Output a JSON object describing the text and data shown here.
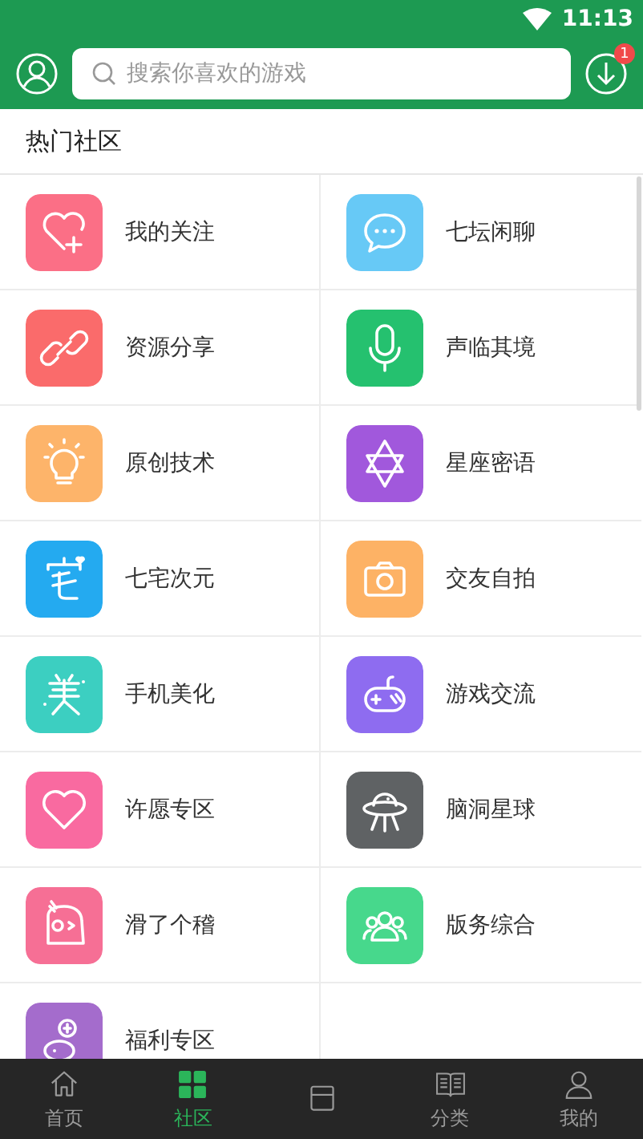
{
  "status_bar": {
    "time": "11:13"
  },
  "header": {
    "search": {
      "placeholder": "搜索你喜欢的游戏"
    },
    "download_badge": "1"
  },
  "section_title": "热门社区",
  "communities": [
    {
      "label": "我的关注",
      "color": "#fb6f86"
    },
    {
      "label": "七坛闲聊",
      "color": "#67c9f6"
    },
    {
      "label": "资源分享",
      "color": "#fa6b6b"
    },
    {
      "label": "声临其境",
      "color": "#25c16f"
    },
    {
      "label": "原创技术",
      "color": "#fdb46a"
    },
    {
      "label": "星座密语",
      "color": "#a158dc"
    },
    {
      "label": "七宅次元",
      "color": "#24aaf0"
    },
    {
      "label": "交友自拍",
      "color": "#fdb265"
    },
    {
      "label": "手机美化",
      "color": "#3ccfc1"
    },
    {
      "label": "游戏交流",
      "color": "#8e6cf0"
    },
    {
      "label": "许愿专区",
      "color": "#f96aa0"
    },
    {
      "label": "脑洞星球",
      "color": "#5f6264"
    },
    {
      "label": "滑了个稽",
      "color": "#f66f95"
    },
    {
      "label": "版务综合",
      "color": "#47d88c"
    },
    {
      "label": "福利专区",
      "color": "#a46ccc"
    }
  ],
  "tabs": [
    {
      "label": "首页",
      "selected": false
    },
    {
      "label": "社区",
      "selected": true
    },
    {
      "selected": false
    },
    {
      "label": "分类",
      "selected": false
    },
    {
      "label": "我的",
      "selected": false
    }
  ]
}
